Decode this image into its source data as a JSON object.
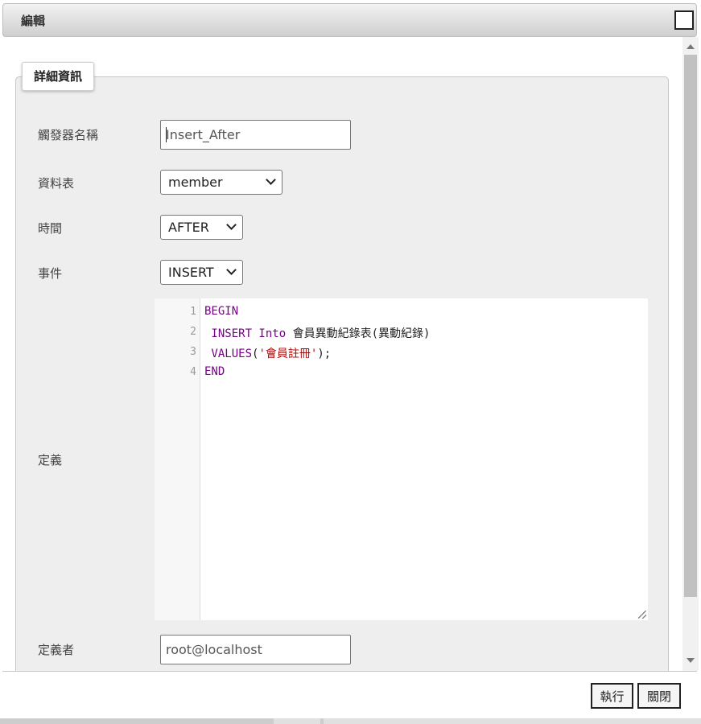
{
  "dialog": {
    "title": "編輯"
  },
  "section": {
    "legend": "詳細資訊"
  },
  "form": {
    "trigger_name_label": "觸發器名稱",
    "trigger_name_value": "Insert_After",
    "table_label": "資料表",
    "table_value": "member",
    "timing_label": "時間",
    "timing_value": "AFTER",
    "event_label": "事件",
    "event_value": "INSERT",
    "definition_label": "定義",
    "definer_label": "定義者",
    "definer_value": "root@localhost"
  },
  "code": {
    "line_numbers": [
      "1",
      "2",
      "3",
      "4"
    ],
    "line1_kw": "BEGIN",
    "line2_kw": " INSERT Into",
    "line2_rest": " 會員異動紀錄表(異動紀錄)",
    "line3_kw": " VALUES",
    "line3_open": "(",
    "line3_str": "'會員註冊'",
    "line3_close": ");",
    "line4_kw": "END"
  },
  "buttons": {
    "execute": "執行",
    "close": "關閉"
  },
  "colors": {
    "keyword": "#770088",
    "string": "#aa1111"
  }
}
